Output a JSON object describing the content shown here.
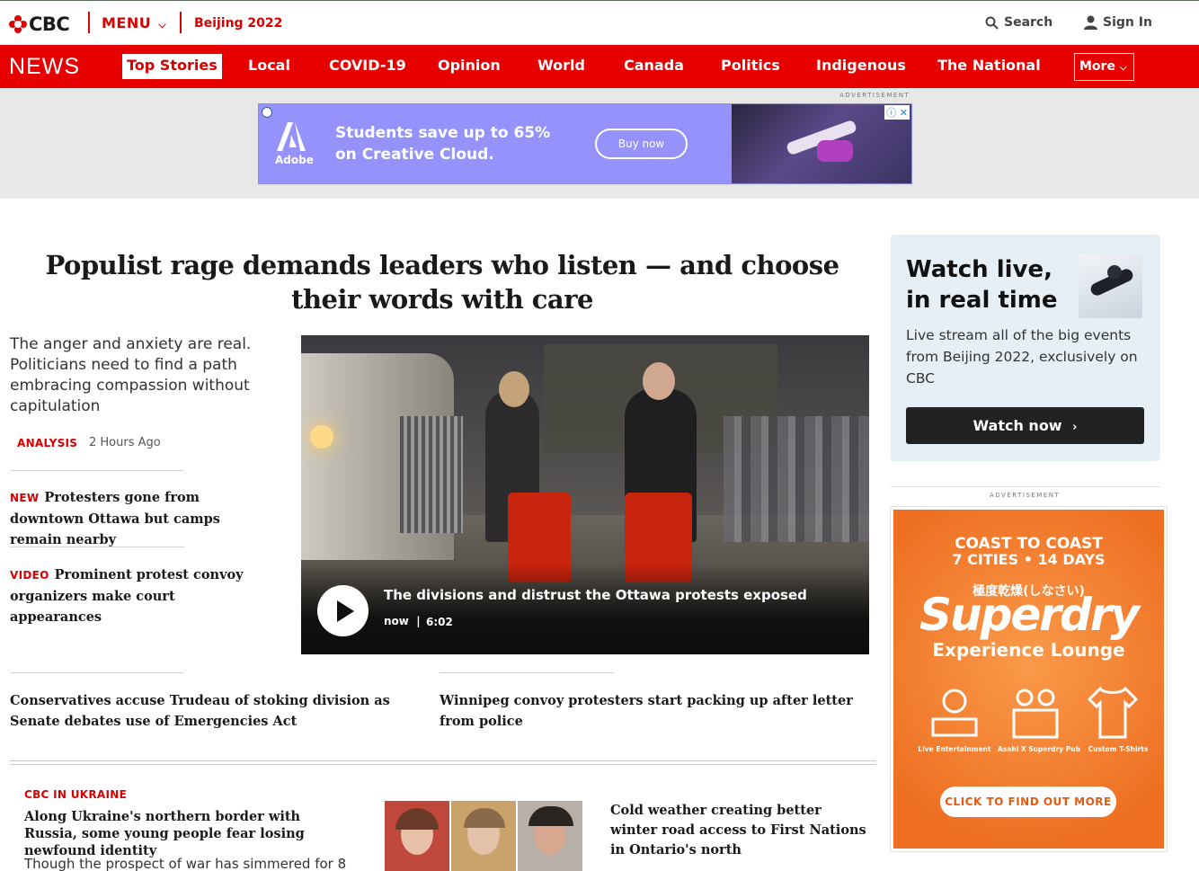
{
  "brand": {
    "logo": "CBC",
    "accent": "#e60000"
  },
  "topbar": {
    "menu_label": "MENU",
    "beijing_label": "Beijing 2022",
    "search_label": "Search",
    "signin_label": "Sign In"
  },
  "nav": {
    "brand": "NEWS",
    "items": [
      "Top Stories",
      "Local",
      "COVID-19",
      "Opinion",
      "World",
      "Canada",
      "Politics",
      "Indigenous",
      "The National"
    ],
    "more_label": "More"
  },
  "ad_top": {
    "label": "ADVERTISEMENT",
    "brand": "Adobe",
    "line1": "Students save up to 65%",
    "line2": "on Creative Cloud.",
    "cta": "Buy now"
  },
  "main": {
    "headline": "Populist rage demands leaders who listen — and choose their words with care",
    "deck": "The anger and anxiety are real. Politicians need to find a path embracing compassion without capitulation",
    "label": "ANALYSIS",
    "time": "2 Hours Ago"
  },
  "side_stories": [
    {
      "tag": "NEW",
      "title": "Protesters gone from downtown Ottawa but camps remain nearby"
    },
    {
      "tag": "VIDEO",
      "title": "Prominent protest convoy organizers make court appearances"
    }
  ],
  "video": {
    "title": "The divisions and distrust the Ottawa protests exposed",
    "when": "now",
    "duration": "6:02"
  },
  "lower_stories": [
    "Conservatives accuse Trudeau of stoking division as Senate debates use of Emergencies Act",
    "Winnipeg convoy protesters start packing up after letter from police"
  ],
  "ukraine": {
    "label": "CBC IN UKRAINE",
    "headline": "Along Ukraine's northern border with Russia, some young people fear losing newfound identity",
    "deck": "Though the prospect of war has simmered for 8"
  },
  "cold_story": "Cold weather creating better winter road access to First Nations in Ontario's north",
  "watch": {
    "title_line1": "Watch live,",
    "title_line2": "in real time",
    "text": "Live stream all of the big events from Beijing 2022, exclusively on CBC",
    "button": "Watch now"
  },
  "ad_right": {
    "label": "ADVERTISEMENT",
    "line1": "COAST TO COAST",
    "line2": "7 CITIES • 14 DAYS",
    "line3": "極度乾燥(しなさい)",
    "brand": "Superdry",
    "line4": "Experience Lounge",
    "captions": [
      "Live Entertainment",
      "Asahi X Superdry Pub",
      "Custom T-Shirts"
    ],
    "cta": "CLICK TO FIND OUT MORE"
  }
}
